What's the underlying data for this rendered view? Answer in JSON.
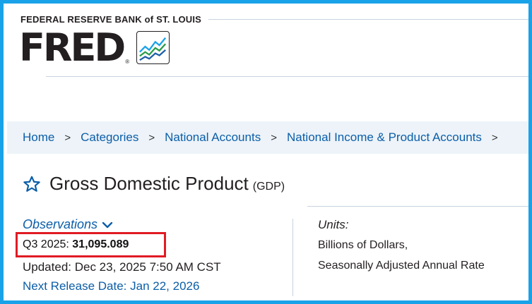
{
  "header": {
    "org_name": "FEDERAL RESERVE BANK of ST. LOUIS",
    "logo_text": "FRED",
    "reg_mark": "®"
  },
  "breadcrumb": {
    "items": [
      "Home",
      "Categories",
      "National Accounts",
      "National Income & Product Accounts"
    ],
    "separator": ">"
  },
  "series": {
    "title": "Gross Domestic Product",
    "id_label": "(GDP)"
  },
  "observations": {
    "link_label": "Observations",
    "period_label": "Q3 2025:",
    "value": "31,095.089",
    "updated": "Updated: Dec 23, 2025 7:50 AM CST",
    "next_release": "Next Release Date: Jan 22, 2026"
  },
  "units": {
    "label": "Units:",
    "line1": "Billions of Dollars,",
    "line2": "Seasonally Adjusted Annual Rate"
  },
  "colors": {
    "frame": "#1aa2e8",
    "link": "#0b5ea8",
    "highlight": "#e01b24",
    "breadcrumb_bg": "#edf3f9"
  },
  "icons": {
    "star": "star-icon",
    "chevron": "chevron-down-icon",
    "logo_chart": "fred-chart-logo-icon"
  }
}
